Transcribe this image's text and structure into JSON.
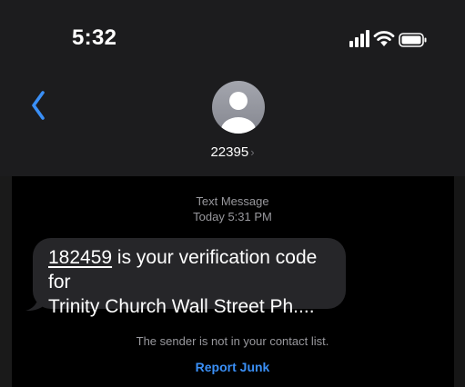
{
  "status_bar": {
    "time": "5:32",
    "icons": [
      "signal-icon",
      "wifi-icon",
      "battery-icon"
    ]
  },
  "nav": {
    "back_icon": "chevron-left-icon",
    "avatar_icon": "person-avatar-icon",
    "contact_name": "22395",
    "contact_chevron": "›"
  },
  "thread": {
    "message_type": "Text Message",
    "timestamp": "Today 5:31 PM",
    "messages": [
      {
        "code": "182459",
        "text_after_code": " is your verification code for",
        "line2": "Trinity Church Wall Street Ph...."
      }
    ],
    "not_in_contacts": "The sender is not in your contact list.",
    "report_junk_label": "Report Junk"
  },
  "colors": {
    "header_bg": "#1c1c1e",
    "background": "#000000",
    "bubble_bg": "#262629",
    "accent_blue": "#3a8ff6",
    "secondary_text": "#98989d"
  }
}
